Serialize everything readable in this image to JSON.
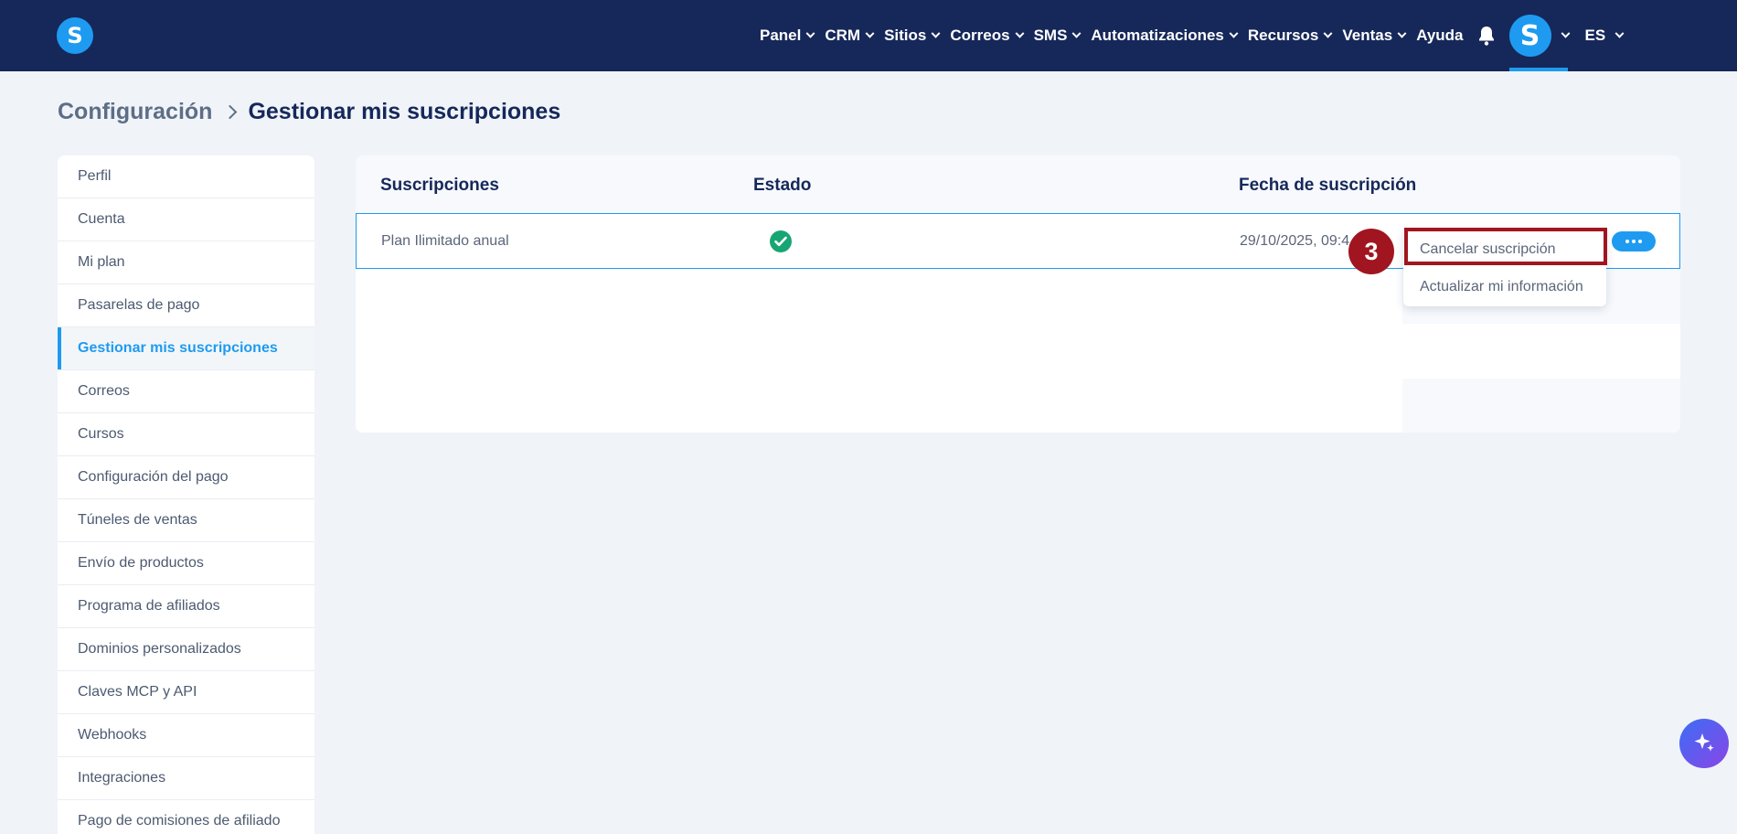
{
  "topbar": {
    "logo_letter": "S",
    "nav": [
      {
        "label": "Panel"
      },
      {
        "label": "CRM"
      },
      {
        "label": "Sitios"
      },
      {
        "label": "Correos"
      },
      {
        "label": "SMS"
      },
      {
        "label": "Automatizaciones"
      },
      {
        "label": "Recursos"
      },
      {
        "label": "Ventas"
      }
    ],
    "help_label": "Ayuda",
    "avatar_letter": "S",
    "language": "ES"
  },
  "breadcrumb": {
    "parent": "Configuración",
    "current": "Gestionar mis suscripciones"
  },
  "sidebar": {
    "items": [
      {
        "label": "Perfil"
      },
      {
        "label": "Cuenta"
      },
      {
        "label": "Mi plan"
      },
      {
        "label": "Pasarelas de pago"
      },
      {
        "label": "Gestionar mis suscripciones"
      },
      {
        "label": "Correos"
      },
      {
        "label": "Cursos"
      },
      {
        "label": "Configuración del pago"
      },
      {
        "label": "Túneles de ventas"
      },
      {
        "label": "Envío de productos"
      },
      {
        "label": "Programa de afiliados"
      },
      {
        "label": "Dominios personalizados"
      },
      {
        "label": "Claves MCP y API"
      },
      {
        "label": "Webhooks"
      },
      {
        "label": "Integraciones"
      },
      {
        "label": "Pago de comisiones de afiliado"
      }
    ],
    "active_index": 4
  },
  "table": {
    "headers": {
      "subscription": "Suscripciones",
      "status": "Estado",
      "date": "Fecha de suscripción"
    },
    "rows": [
      {
        "plan": "Plan Ilimitado anual",
        "status_icon": "check-circle-icon",
        "date": "29/10/2025, 09:4"
      }
    ]
  },
  "dropdown": {
    "items": [
      {
        "label": "Cancelar suscripción"
      },
      {
        "label": "Actualizar mi información"
      }
    ]
  },
  "annotation": {
    "step": "3",
    "color": "#a0151f"
  },
  "colors": {
    "topbar": "#16285a",
    "accent": "#1e9bf0",
    "success": "#17a673"
  }
}
